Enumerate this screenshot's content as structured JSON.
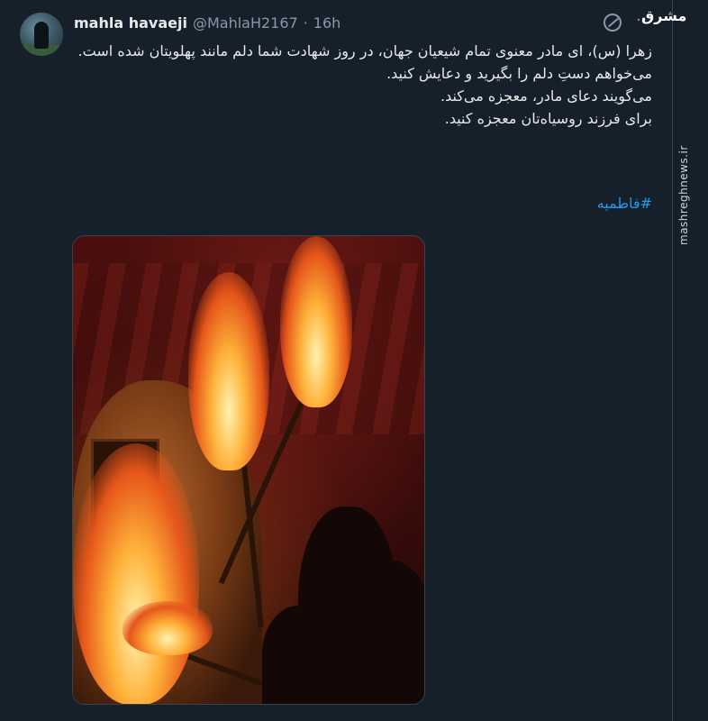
{
  "tweet": {
    "author_name": "mahla havaeji",
    "handle": "@MahlaH2167",
    "separator": "·",
    "time": "16h",
    "more_label": "···",
    "lines": [
      "زهرا (س)، ای مادر معنوی تمام شیعیان جهان، در روز شهادت شما دلم مانند پهلویتان شده است.",
      "می‌خواهم دستِ دلم را بگیرید و دعایش کنید.",
      "می‌گویند دعای مادر، معجزه می‌کند.",
      "برای فرزند روسیاه‌تان معجزه کنید."
    ],
    "hashtag": "#فاطمیه"
  },
  "watermark": {
    "logo": "مشرق",
    "site": "mashreghnews.ir"
  },
  "icons": {
    "grok": "grok-icon",
    "more": "more-options-icon"
  },
  "colors": {
    "background": "#15202b",
    "link": "#1d9bf0",
    "secondary_text": "#8b98a5"
  }
}
